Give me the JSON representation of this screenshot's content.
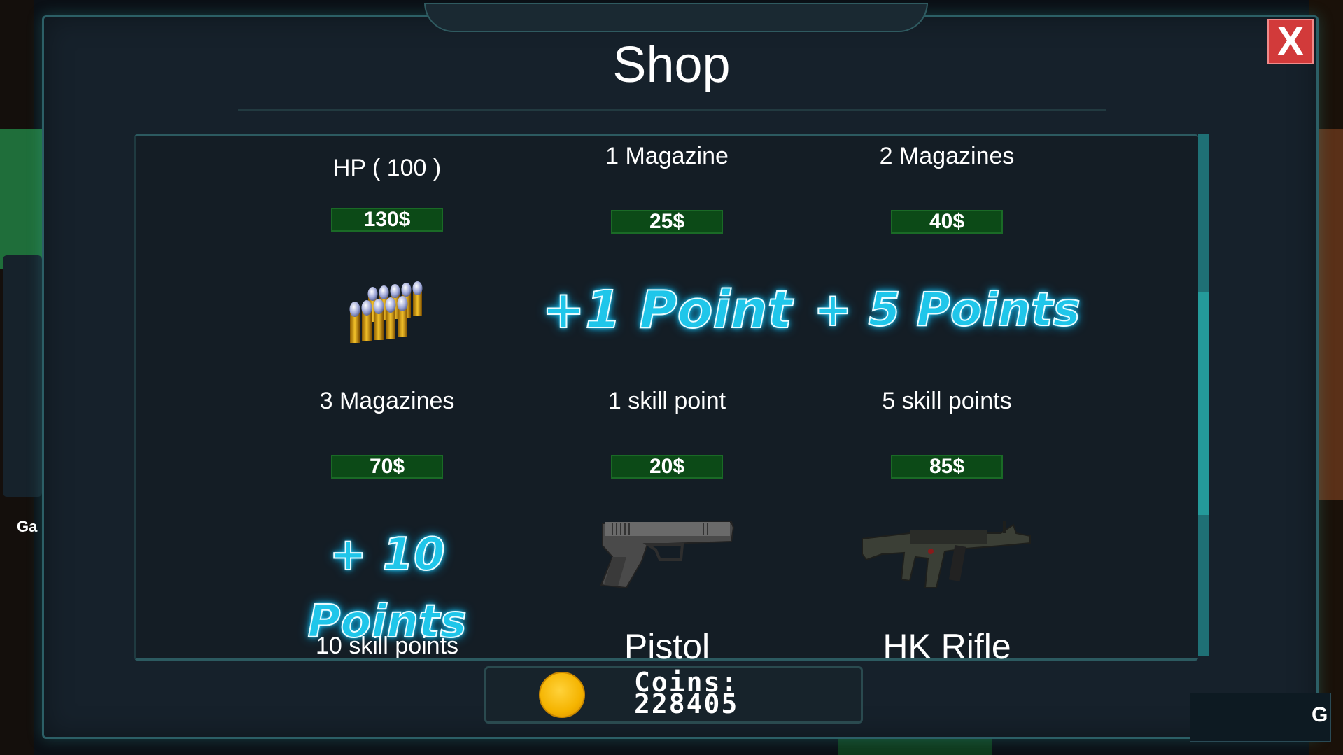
{
  "shop": {
    "title": "Shop",
    "close_label": "X"
  },
  "items": [
    {
      "name": "HP ( 100 )",
      "price": "130$",
      "icon": "ammo-bullets-icon"
    },
    {
      "name": "1 Magazine",
      "price": "25$",
      "icon_text": "+1 Point"
    },
    {
      "name": "2 Magazines",
      "price": "40$",
      "icon_text": "+ 5 Points"
    },
    {
      "name": "3 Magazines",
      "price": "70$",
      "icon_text": "+ 10 Points"
    },
    {
      "name": "1 skill point",
      "price": "20$",
      "icon": "pistol-icon"
    },
    {
      "name": "5 skill points",
      "price": "85$",
      "icon": "hk-rifle-icon"
    },
    {
      "name": "10 skill points"
    },
    {
      "name": "Pistol"
    },
    {
      "name": "HK Rifle"
    }
  ],
  "coins": {
    "label": "Coins:",
    "value": "228405",
    "icon": "coin-icon"
  },
  "background": {
    "left_text": "Ga",
    "right_text": "G"
  },
  "colors": {
    "modal_bg": "#16212b",
    "accent_border": "#2c5f66",
    "price_bg": "#0c4a17",
    "close_bg": "#d23a3a",
    "glow_text": "#1fc6ea",
    "coin": "#f5b400"
  }
}
